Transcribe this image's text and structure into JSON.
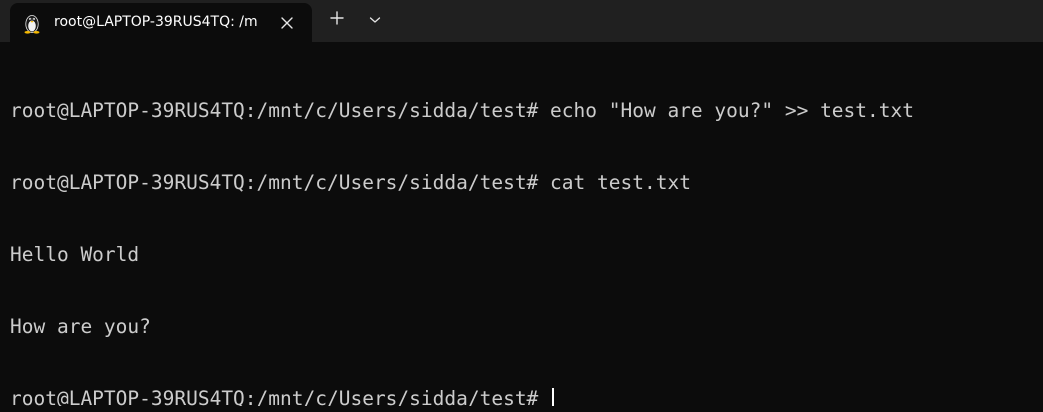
{
  "tab": {
    "title": "root@LAPTOP-39RUS4TQ: /m",
    "icon": "linux-tux-icon",
    "close_icon": "close-icon"
  },
  "toolbar": {
    "new_tab_icon": "plus-icon",
    "dropdown_icon": "chevron-down-icon"
  },
  "terminal": {
    "prompt": "root@LAPTOP-39RUS4TQ:/mnt/c/Users/sidda/test#",
    "lines": [
      {
        "kind": "command",
        "prompt": "root@LAPTOP-39RUS4TQ:/mnt/c/Users/sidda/test#",
        "command": " echo \"How are you?\" >> test.txt"
      },
      {
        "kind": "command",
        "prompt": "root@LAPTOP-39RUS4TQ:/mnt/c/Users/sidda/test#",
        "command": " cat test.txt"
      },
      {
        "kind": "output",
        "text": "Hello World"
      },
      {
        "kind": "output",
        "text": "How are you?"
      }
    ]
  },
  "colors": {
    "background": "#0c0c0c",
    "titlebar": "#202020",
    "text": "#cccccc",
    "cursor": "#ffffff"
  }
}
